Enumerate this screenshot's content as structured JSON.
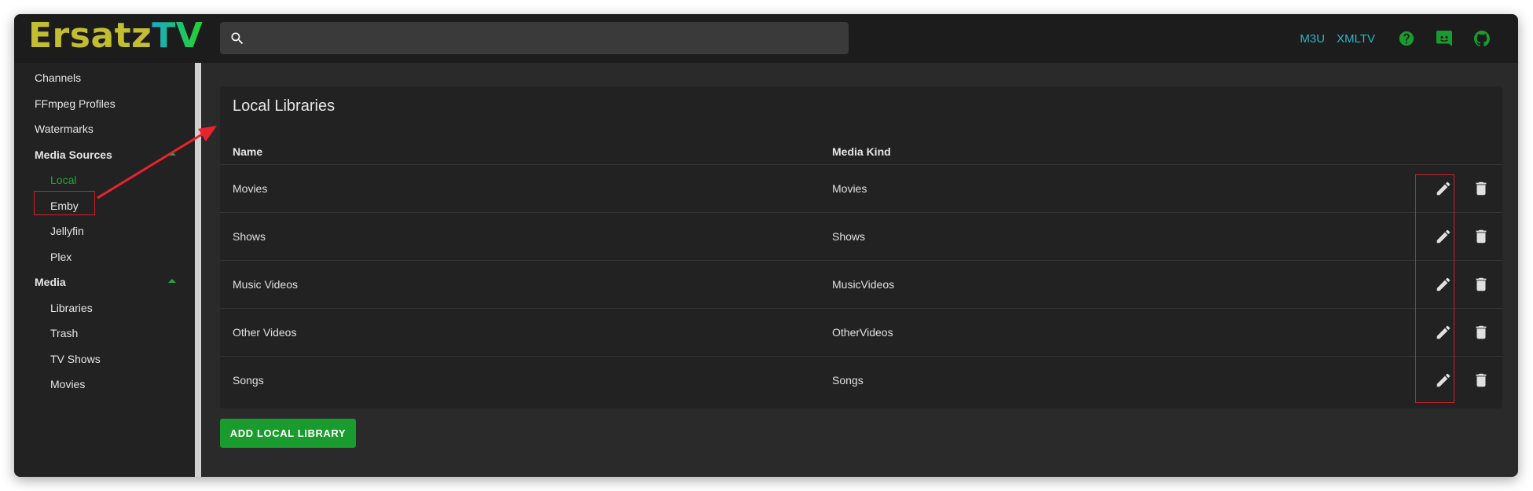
{
  "app": {
    "logo_part1": "Ersatz",
    "logo_part2": "TV"
  },
  "search": {
    "value": "",
    "placeholder": "",
    "icon": "search-icon"
  },
  "header_links": {
    "m3u": "M3U",
    "xmltv": "XMLTV",
    "icons": [
      "help-icon",
      "discord-icon",
      "github-icon"
    ]
  },
  "sidebar": {
    "items": [
      {
        "label": "Channels"
      },
      {
        "label": "FFmpeg Profiles"
      },
      {
        "label": "Watermarks"
      },
      {
        "label": "Media Sources"
      },
      {
        "label": "Local"
      },
      {
        "label": "Emby"
      },
      {
        "label": "Jellyfin"
      },
      {
        "label": "Plex"
      },
      {
        "label": "Media"
      },
      {
        "label": "Libraries"
      },
      {
        "label": "Trash"
      },
      {
        "label": "TV Shows"
      },
      {
        "label": "Movies"
      }
    ]
  },
  "main": {
    "title": "Local Libraries",
    "columns": [
      "Name",
      "Media Kind"
    ],
    "rows": [
      {
        "name": "Movies",
        "kind": "Movies"
      },
      {
        "name": "Shows",
        "kind": "Shows"
      },
      {
        "name": "Music Videos",
        "kind": "MusicVideos"
      },
      {
        "name": "Other Videos",
        "kind": "OtherVideos"
      },
      {
        "name": "Songs",
        "kind": "Songs"
      }
    ],
    "row_actions": [
      "edit-icon",
      "delete-icon"
    ],
    "add_button": "ADD LOCAL LIBRARY"
  },
  "colors": {
    "accent_green": "#24a83b",
    "link_cyan": "#2cb6c4",
    "annotation_red": "#d0202a",
    "background": "#2a2a2a"
  }
}
